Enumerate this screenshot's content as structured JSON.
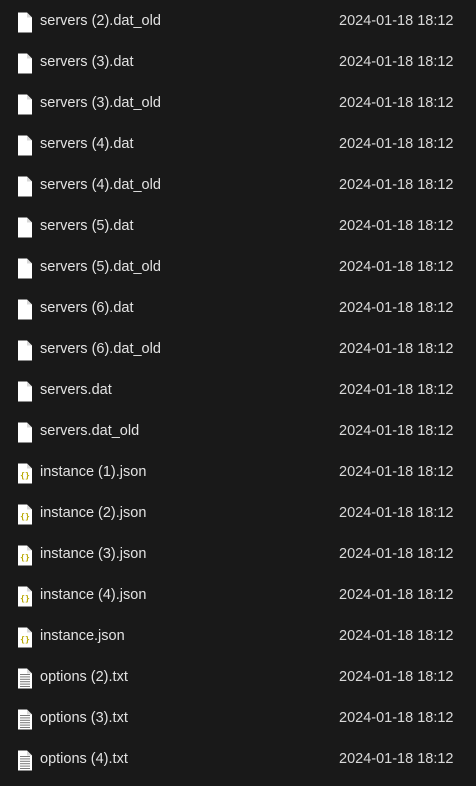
{
  "files": [
    {
      "name": "servers (2).dat_old",
      "modified": "2024-01-18 18:12",
      "icon": "blank-file-icon"
    },
    {
      "name": "servers (3).dat",
      "modified": "2024-01-18 18:12",
      "icon": "blank-file-icon"
    },
    {
      "name": "servers (3).dat_old",
      "modified": "2024-01-18 18:12",
      "icon": "blank-file-icon"
    },
    {
      "name": "servers (4).dat",
      "modified": "2024-01-18 18:12",
      "icon": "blank-file-icon"
    },
    {
      "name": "servers (4).dat_old",
      "modified": "2024-01-18 18:12",
      "icon": "blank-file-icon"
    },
    {
      "name": "servers (5).dat",
      "modified": "2024-01-18 18:12",
      "icon": "blank-file-icon"
    },
    {
      "name": "servers (5).dat_old",
      "modified": "2024-01-18 18:12",
      "icon": "blank-file-icon"
    },
    {
      "name": "servers (6).dat",
      "modified": "2024-01-18 18:12",
      "icon": "blank-file-icon"
    },
    {
      "name": "servers (6).dat_old",
      "modified": "2024-01-18 18:12",
      "icon": "blank-file-icon"
    },
    {
      "name": "servers.dat",
      "modified": "2024-01-18 18:12",
      "icon": "blank-file-icon"
    },
    {
      "name": "servers.dat_old",
      "modified": "2024-01-18 18:12",
      "icon": "blank-file-icon"
    },
    {
      "name": "instance (1).json",
      "modified": "2024-01-18 18:12",
      "icon": "json-file-icon"
    },
    {
      "name": "instance (2).json",
      "modified": "2024-01-18 18:12",
      "icon": "json-file-icon"
    },
    {
      "name": "instance (3).json",
      "modified": "2024-01-18 18:12",
      "icon": "json-file-icon"
    },
    {
      "name": "instance (4).json",
      "modified": "2024-01-18 18:12",
      "icon": "json-file-icon"
    },
    {
      "name": "instance.json",
      "modified": "2024-01-18 18:12",
      "icon": "json-file-icon"
    },
    {
      "name": "options (2).txt",
      "modified": "2024-01-18 18:12",
      "icon": "text-file-icon"
    },
    {
      "name": "options (3).txt",
      "modified": "2024-01-18 18:12",
      "icon": "text-file-icon"
    },
    {
      "name": "options (4).txt",
      "modified": "2024-01-18 18:12",
      "icon": "text-file-icon"
    }
  ],
  "colors": {
    "background": "#191919",
    "text": "#e3e3e3",
    "icon_page": "#ffffff",
    "json_brace": "#c8b400"
  }
}
